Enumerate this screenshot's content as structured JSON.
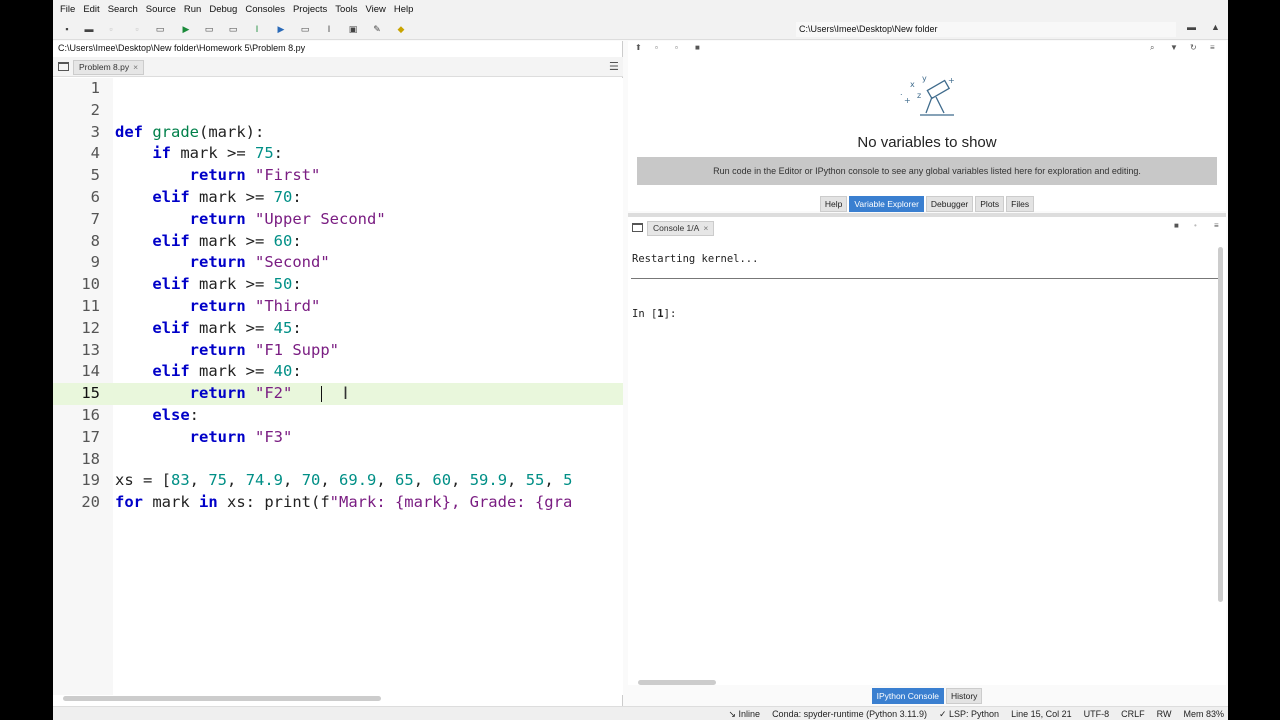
{
  "menu": [
    "File",
    "Edit",
    "Search",
    "Source",
    "Run",
    "Debug",
    "Consoles",
    "Projects",
    "Tools",
    "View",
    "Help"
  ],
  "toolbar": {
    "working_dir": "C:\\Users\\Imee\\Desktop\\New folder"
  },
  "editor": {
    "file_path": "C:\\Users\\Imee\\Desktop\\New folder\\Homework 5\\Problem 8.py",
    "tab_label": "Problem 8.py",
    "current_line": 15,
    "lines": [
      {
        "n": "1",
        "tokens": []
      },
      {
        "n": "2",
        "tokens": []
      },
      {
        "n": "3",
        "tokens": [
          {
            "t": "kw",
            "v": "def "
          },
          {
            "t": "fn",
            "v": "grade"
          },
          {
            "t": "",
            "v": "(mark):"
          }
        ]
      },
      {
        "n": "4",
        "tokens": [
          {
            "t": "",
            "v": "    "
          },
          {
            "t": "kw",
            "v": "if"
          },
          {
            "t": "",
            "v": " mark >= "
          },
          {
            "t": "num",
            "v": "75"
          },
          {
            "t": "",
            "v": ":"
          }
        ]
      },
      {
        "n": "5",
        "tokens": [
          {
            "t": "",
            "v": "        "
          },
          {
            "t": "kw",
            "v": "return"
          },
          {
            "t": "",
            "v": " "
          },
          {
            "t": "str",
            "v": "\"First\""
          }
        ]
      },
      {
        "n": "6",
        "tokens": [
          {
            "t": "",
            "v": "    "
          },
          {
            "t": "kw",
            "v": "elif"
          },
          {
            "t": "",
            "v": " mark >= "
          },
          {
            "t": "num",
            "v": "70"
          },
          {
            "t": "",
            "v": ":"
          }
        ]
      },
      {
        "n": "7",
        "tokens": [
          {
            "t": "",
            "v": "        "
          },
          {
            "t": "kw",
            "v": "return"
          },
          {
            "t": "",
            "v": " "
          },
          {
            "t": "str",
            "v": "\"Upper Second\""
          }
        ]
      },
      {
        "n": "8",
        "tokens": [
          {
            "t": "",
            "v": "    "
          },
          {
            "t": "kw",
            "v": "elif"
          },
          {
            "t": "",
            "v": " mark >= "
          },
          {
            "t": "num",
            "v": "60"
          },
          {
            "t": "",
            "v": ":"
          }
        ]
      },
      {
        "n": "9",
        "tokens": [
          {
            "t": "",
            "v": "        "
          },
          {
            "t": "kw",
            "v": "return"
          },
          {
            "t": "",
            "v": " "
          },
          {
            "t": "str",
            "v": "\"Second\""
          }
        ]
      },
      {
        "n": "10",
        "tokens": [
          {
            "t": "",
            "v": "    "
          },
          {
            "t": "kw",
            "v": "elif"
          },
          {
            "t": "",
            "v": " mark >= "
          },
          {
            "t": "num",
            "v": "50"
          },
          {
            "t": "",
            "v": ":"
          }
        ]
      },
      {
        "n": "11",
        "tokens": [
          {
            "t": "",
            "v": "        "
          },
          {
            "t": "kw",
            "v": "return"
          },
          {
            "t": "",
            "v": " "
          },
          {
            "t": "str",
            "v": "\"Third\""
          }
        ]
      },
      {
        "n": "12",
        "tokens": [
          {
            "t": "",
            "v": "    "
          },
          {
            "t": "kw",
            "v": "elif"
          },
          {
            "t": "",
            "v": " mark >= "
          },
          {
            "t": "num",
            "v": "45"
          },
          {
            "t": "",
            "v": ":"
          }
        ]
      },
      {
        "n": "13",
        "tokens": [
          {
            "t": "",
            "v": "        "
          },
          {
            "t": "kw",
            "v": "return"
          },
          {
            "t": "",
            "v": " "
          },
          {
            "t": "str",
            "v": "\"F1 Supp\""
          }
        ]
      },
      {
        "n": "14",
        "tokens": [
          {
            "t": "",
            "v": "    "
          },
          {
            "t": "kw",
            "v": "elif"
          },
          {
            "t": "",
            "v": " mark >= "
          },
          {
            "t": "num",
            "v": "40"
          },
          {
            "t": "",
            "v": ":"
          }
        ]
      },
      {
        "n": "15",
        "tokens": [
          {
            "t": "",
            "v": "        "
          },
          {
            "t": "kw",
            "v": "return"
          },
          {
            "t": "",
            "v": " "
          },
          {
            "t": "str",
            "v": "\"F2\""
          },
          {
            "t": "",
            "v": " "
          }
        ]
      },
      {
        "n": "16",
        "tokens": [
          {
            "t": "",
            "v": "    "
          },
          {
            "t": "kw",
            "v": "else"
          },
          {
            "t": "",
            "v": ":"
          }
        ]
      },
      {
        "n": "17",
        "tokens": [
          {
            "t": "",
            "v": "        "
          },
          {
            "t": "kw",
            "v": "return"
          },
          {
            "t": "",
            "v": " "
          },
          {
            "t": "str",
            "v": "\"F3\""
          }
        ]
      },
      {
        "n": "18",
        "tokens": []
      },
      {
        "n": "19",
        "tokens": [
          {
            "t": "",
            "v": "xs = ["
          },
          {
            "t": "num",
            "v": "83"
          },
          {
            "t": "",
            "v": ", "
          },
          {
            "t": "num",
            "v": "75"
          },
          {
            "t": "",
            "v": ", "
          },
          {
            "t": "num",
            "v": "74.9"
          },
          {
            "t": "",
            "v": ", "
          },
          {
            "t": "num",
            "v": "70"
          },
          {
            "t": "",
            "v": ", "
          },
          {
            "t": "num",
            "v": "69.9"
          },
          {
            "t": "",
            "v": ", "
          },
          {
            "t": "num",
            "v": "65"
          },
          {
            "t": "",
            "v": ", "
          },
          {
            "t": "num",
            "v": "60"
          },
          {
            "t": "",
            "v": ", "
          },
          {
            "t": "num",
            "v": "59.9"
          },
          {
            "t": "",
            "v": ", "
          },
          {
            "t": "num",
            "v": "55"
          },
          {
            "t": "",
            "v": ", "
          },
          {
            "t": "num",
            "v": "5"
          }
        ]
      },
      {
        "n": "20",
        "tokens": [
          {
            "t": "kw",
            "v": "for"
          },
          {
            "t": "",
            "v": " mark "
          },
          {
            "t": "kw",
            "v": "in"
          },
          {
            "t": "",
            "v": " xs: print(f"
          },
          {
            "t": "str",
            "v": "\"Mark: {mark}, Grade: {gra"
          }
        ]
      }
    ]
  },
  "variable_explorer": {
    "empty_title": "No variables to show",
    "empty_hint": "Run code in the Editor or IPython console to see any global variables listed here for exploration and editing."
  },
  "pane_tabs": [
    {
      "label": "Help",
      "active": false
    },
    {
      "label": "Variable Explorer",
      "active": true
    },
    {
      "label": "Debugger",
      "active": false
    },
    {
      "label": "Plots",
      "active": false
    },
    {
      "label": "Files",
      "active": false
    }
  ],
  "console": {
    "tab_label": "Console 1/A",
    "restart_msg": "Restarting kernel...",
    "prompt_prefix": "In [",
    "prompt_num": "1",
    "prompt_suffix": "]:"
  },
  "bottom_tabs": [
    {
      "label": "IPython Console",
      "active": true
    },
    {
      "label": "History",
      "active": false
    }
  ],
  "status": {
    "inline": "Inline",
    "conda": "Conda: spyder-runtime (Python 3.11.9)",
    "lsp": "LSP: Python",
    "position": "Line 15, Col 21",
    "encoding": "UTF-8",
    "eol": "CRLF",
    "mode": "RW",
    "mem": "Mem 83%"
  },
  "colors": {
    "accent": "#3a7fd0",
    "keyword": "#0000c8",
    "function": "#00804a",
    "number": "#008f86",
    "string": "#7a1d82",
    "current_line": "#e9f7dc"
  }
}
